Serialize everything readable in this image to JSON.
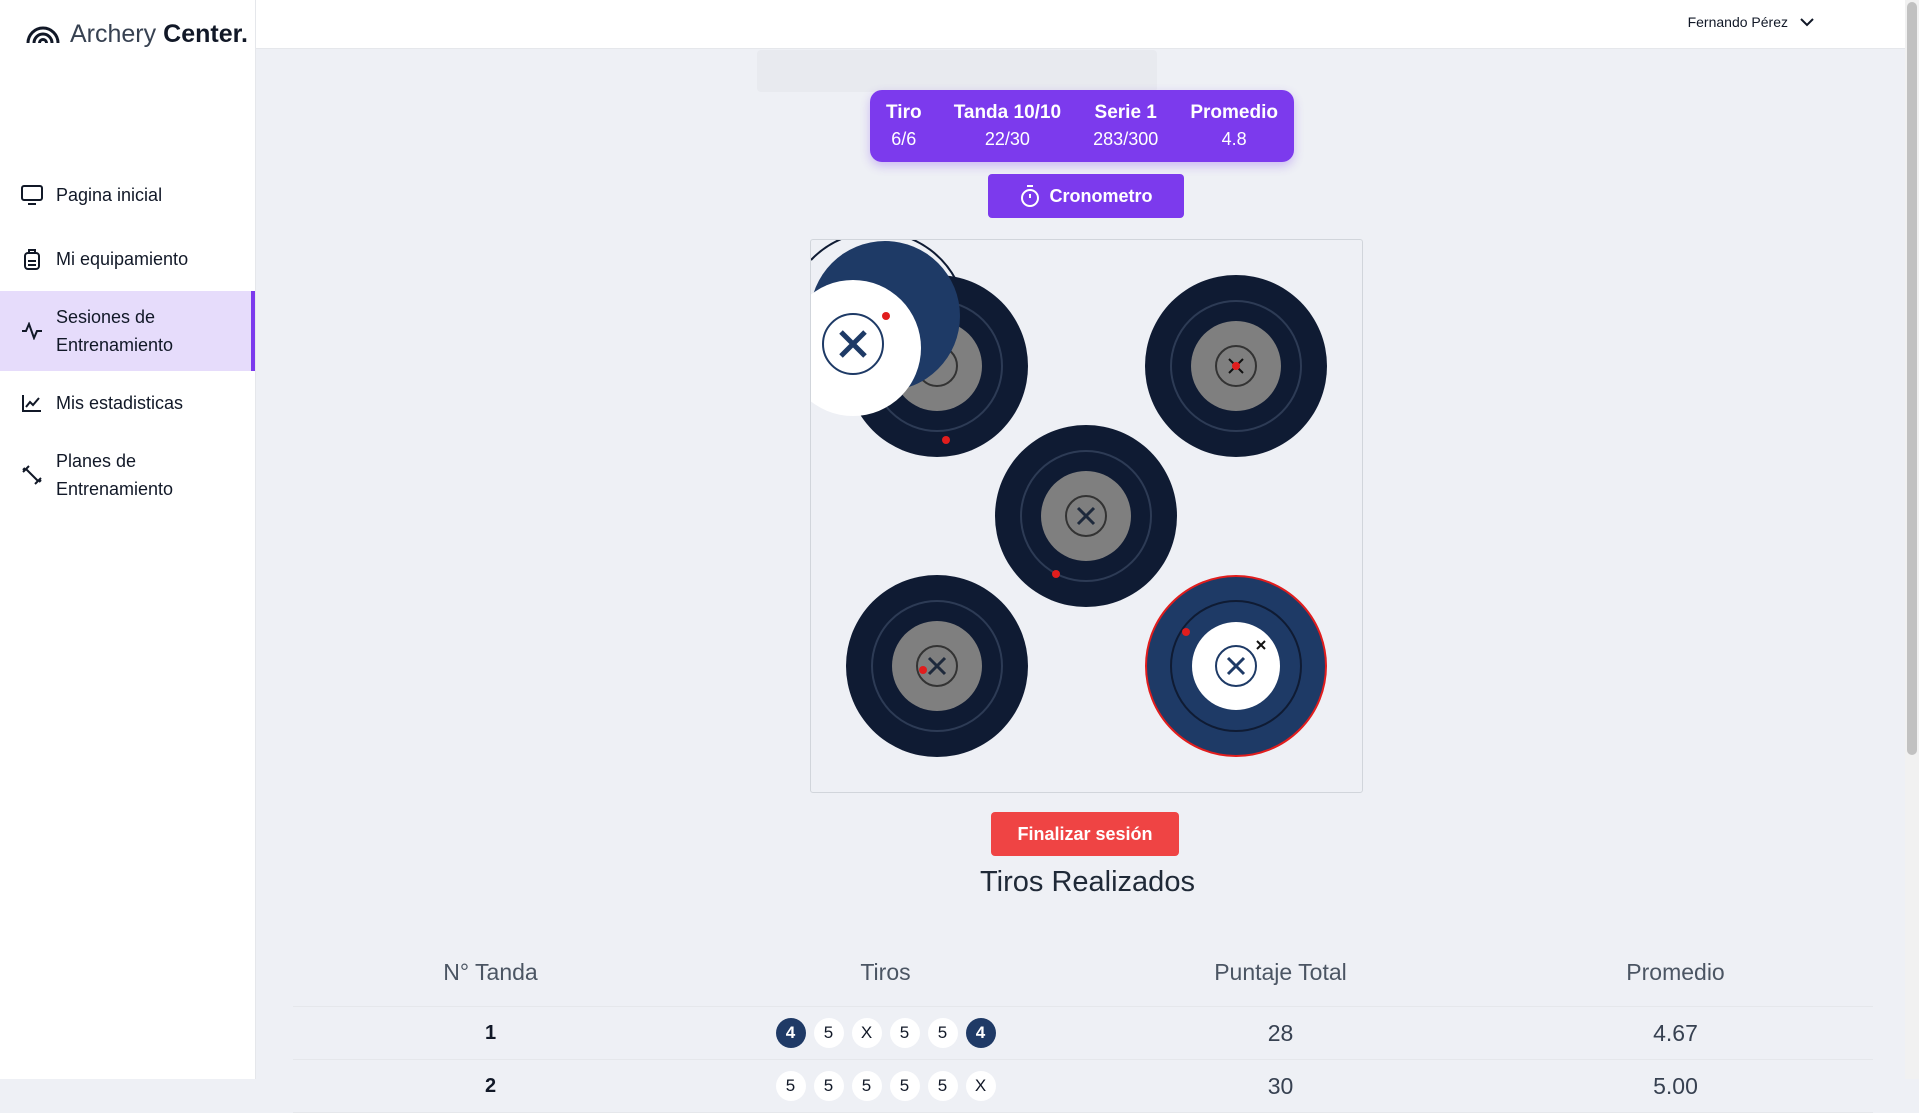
{
  "brand": {
    "light": "Archery",
    "bold": "Center."
  },
  "nav": [
    {
      "label": "Pagina inicial",
      "icon": "monitor-icon"
    },
    {
      "label": "Mi equipamiento",
      "icon": "backpack-icon"
    },
    {
      "label": "Sesiones de",
      "label2": "Entrenamiento",
      "icon": "activity-icon",
      "active": true
    },
    {
      "label": "Mis estadisticas",
      "icon": "chart-icon"
    },
    {
      "label": "Planes de",
      "label2": "Entrenamiento",
      "icon": "dumbbell-icon"
    }
  ],
  "user": {
    "name": "Fernando Pérez"
  },
  "stats": [
    {
      "k": "Tiro",
      "v": "6/6"
    },
    {
      "k": "Tanda 10/10",
      "v": "22/30"
    },
    {
      "k": "Serie 1",
      "v": "283/300"
    },
    {
      "k": "Promedio",
      "v": "4.8"
    }
  ],
  "buttons": {
    "crono": "Cronometro",
    "finish": "Finalizar sesión"
  },
  "subtitle": "Tiros Realizados",
  "table": {
    "headers": [
      "N° Tanda",
      "Tiros",
      "Puntaje Total",
      "Promedio"
    ],
    "rows": [
      {
        "n": "1",
        "shots": [
          {
            "v": "4",
            "dark": true
          },
          {
            "v": "5"
          },
          {
            "v": "X"
          },
          {
            "v": "5"
          },
          {
            "v": "5"
          },
          {
            "v": "4",
            "dark": true
          }
        ],
        "total": "28",
        "avg": "4.67"
      },
      {
        "n": "2",
        "shots": [
          {
            "v": "5"
          },
          {
            "v": "5"
          },
          {
            "v": "5"
          },
          {
            "v": "5"
          },
          {
            "v": "5"
          },
          {
            "v": "X"
          }
        ],
        "total": "30",
        "avg": "5.00"
      }
    ]
  },
  "colors": {
    "accent": "#7c3aed",
    "danger": "#ef4444",
    "target_dark": "#0f1b33",
    "target_blue": "#1e3a66"
  }
}
